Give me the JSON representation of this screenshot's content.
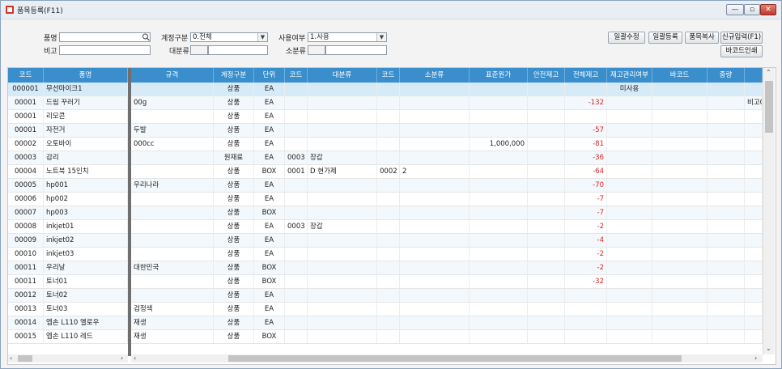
{
  "window": {
    "title": "품목등록(F11)",
    "minimize": "—",
    "maximize": "▫",
    "close": "✕"
  },
  "filters": {
    "name_label": "품명",
    "name_value": "",
    "memo_label": "비고",
    "memo_value": "",
    "account_label": "계정구분",
    "account_value": "0.전체",
    "major_label": "대분류",
    "major_value": "",
    "use_label": "사용여부",
    "use_value": "1.사용",
    "minor_label": "소분류",
    "minor_value": ""
  },
  "buttons": {
    "bulk_edit": "일괄수정",
    "bulk_register": "일괄등록",
    "copy_item": "품목복사",
    "new_input": "신규입력(F1)",
    "barcode_print": "바코드인쇄"
  },
  "columns": [
    "코드",
    "품명",
    "규격",
    "계정구분",
    "단위",
    "코드",
    "대분류",
    "코드",
    "소분류",
    "표준원가",
    "안전재고",
    "전체재고",
    "재고관리여부",
    "바코드",
    "중량",
    ""
  ],
  "rows": [
    {
      "code": "000001",
      "name": "무선마이크1",
      "spec": "",
      "acct": "상품",
      "unit": "EA",
      "mcode": "",
      "major": "",
      "scode": "",
      "minor": "",
      "cost": "",
      "safety": "",
      "total": "",
      "stockmgmt": "미사용",
      "barcode": "",
      "weight": "",
      "extra": ""
    },
    {
      "code": "00001",
      "name": "드림 꾸러기",
      "spec": "00g",
      "acct": "상품",
      "unit": "EA",
      "mcode": "",
      "major": "",
      "scode": "",
      "minor": "",
      "cost": "",
      "safety": "",
      "total": "-132",
      "stockmgmt": "",
      "barcode": "",
      "weight": "",
      "extra": "비고0"
    },
    {
      "code": "00001",
      "name": "리모콘",
      "spec": "",
      "acct": "상품",
      "unit": "EA",
      "mcode": "",
      "major": "",
      "scode": "",
      "minor": "",
      "cost": "",
      "safety": "",
      "total": "",
      "stockmgmt": "",
      "barcode": "",
      "weight": "",
      "extra": ""
    },
    {
      "code": "00001",
      "name": "자전거",
      "spec": "두발",
      "acct": "상품",
      "unit": "EA",
      "mcode": "",
      "major": "",
      "scode": "",
      "minor": "",
      "cost": "",
      "safety": "",
      "total": "-57",
      "stockmgmt": "",
      "barcode": "",
      "weight": "",
      "extra": ""
    },
    {
      "code": "00002",
      "name": "오토바이",
      "spec": "000cc",
      "acct": "상품",
      "unit": "EA",
      "mcode": "",
      "major": "",
      "scode": "",
      "minor": "",
      "cost": "1,000,000",
      "safety": "",
      "total": "-81",
      "stockmgmt": "",
      "barcode": "",
      "weight": "",
      "extra": ""
    },
    {
      "code": "00003",
      "name": "감리",
      "spec": "",
      "acct": "원재료",
      "unit": "EA",
      "mcode": "0003",
      "major": "장갑",
      "scode": "",
      "minor": "",
      "cost": "",
      "safety": "",
      "total": "-36",
      "stockmgmt": "",
      "barcode": "",
      "weight": "",
      "extra": ""
    },
    {
      "code": "00004",
      "name": "노트북 15인치",
      "spec": "",
      "acct": "상품",
      "unit": "BOX",
      "mcode": "0001",
      "major": "D 현가제",
      "scode": "0002",
      "minor": "2",
      "cost": "",
      "safety": "",
      "total": "-64",
      "stockmgmt": "",
      "barcode": "",
      "weight": "",
      "extra": ""
    },
    {
      "code": "00005",
      "name": "hp001",
      "spec": "우리나라",
      "acct": "상품",
      "unit": "EA",
      "mcode": "",
      "major": "",
      "scode": "",
      "minor": "",
      "cost": "",
      "safety": "",
      "total": "-70",
      "stockmgmt": "",
      "barcode": "",
      "weight": "",
      "extra": ""
    },
    {
      "code": "00006",
      "name": "hp002",
      "spec": "",
      "acct": "상품",
      "unit": "EA",
      "mcode": "",
      "major": "",
      "scode": "",
      "minor": "",
      "cost": "",
      "safety": "",
      "total": "-7",
      "stockmgmt": "",
      "barcode": "",
      "weight": "",
      "extra": ""
    },
    {
      "code": "00007",
      "name": "hp003",
      "spec": "",
      "acct": "상품",
      "unit": "BOX",
      "mcode": "",
      "major": "",
      "scode": "",
      "minor": "",
      "cost": "",
      "safety": "",
      "total": "-7",
      "stockmgmt": "",
      "barcode": "",
      "weight": "",
      "extra": ""
    },
    {
      "code": "00008",
      "name": "inkjet01",
      "spec": "",
      "acct": "상품",
      "unit": "EA",
      "mcode": "0003",
      "major": "장갑",
      "scode": "",
      "minor": "",
      "cost": "",
      "safety": "",
      "total": "-2",
      "stockmgmt": "",
      "barcode": "",
      "weight": "",
      "extra": ""
    },
    {
      "code": "00009",
      "name": "inkjet02",
      "spec": "",
      "acct": "상품",
      "unit": "EA",
      "mcode": "",
      "major": "",
      "scode": "",
      "minor": "",
      "cost": "",
      "safety": "",
      "total": "-4",
      "stockmgmt": "",
      "barcode": "",
      "weight": "",
      "extra": ""
    },
    {
      "code": "00010",
      "name": "inkjet03",
      "spec": "",
      "acct": "상품",
      "unit": "EA",
      "mcode": "",
      "major": "",
      "scode": "",
      "minor": "",
      "cost": "",
      "safety": "",
      "total": "-2",
      "stockmgmt": "",
      "barcode": "",
      "weight": "",
      "extra": ""
    },
    {
      "code": "00011",
      "name": "우리날",
      "spec": "대한민국",
      "acct": "상품",
      "unit": "BOX",
      "mcode": "",
      "major": "",
      "scode": "",
      "minor": "",
      "cost": "",
      "safety": "",
      "total": "-2",
      "stockmgmt": "",
      "barcode": "",
      "weight": "",
      "extra": ""
    },
    {
      "code": "00011",
      "name": "토너01",
      "spec": "",
      "acct": "상품",
      "unit": "BOX",
      "mcode": "",
      "major": "",
      "scode": "",
      "minor": "",
      "cost": "",
      "safety": "",
      "total": "-32",
      "stockmgmt": "",
      "barcode": "",
      "weight": "",
      "extra": ""
    },
    {
      "code": "00012",
      "name": "토너02",
      "spec": "",
      "acct": "상품",
      "unit": "EA",
      "mcode": "",
      "major": "",
      "scode": "",
      "minor": "",
      "cost": "",
      "safety": "",
      "total": "",
      "stockmgmt": "",
      "barcode": "",
      "weight": "",
      "extra": ""
    },
    {
      "code": "00013",
      "name": "토너03",
      "spec": "검정색",
      "acct": "상품",
      "unit": "EA",
      "mcode": "",
      "major": "",
      "scode": "",
      "minor": "",
      "cost": "",
      "safety": "",
      "total": "",
      "stockmgmt": "",
      "barcode": "",
      "weight": "",
      "extra": ""
    },
    {
      "code": "00014",
      "name": "엡손 L110 옐로우",
      "spec": "재생",
      "acct": "상품",
      "unit": "EA",
      "mcode": "",
      "major": "",
      "scode": "",
      "minor": "",
      "cost": "",
      "safety": "",
      "total": "",
      "stockmgmt": "",
      "barcode": "",
      "weight": "",
      "extra": ""
    },
    {
      "code": "00015",
      "name": "엡손 L110 레드",
      "spec": "재생",
      "acct": "상품",
      "unit": "BOX",
      "mcode": "",
      "major": "",
      "scode": "",
      "minor": "",
      "cost": "",
      "safety": "",
      "total": "",
      "stockmgmt": "",
      "barcode": "",
      "weight": "",
      "extra": ""
    }
  ],
  "colors": {
    "header": "#3a8ecb",
    "selected_row": "#d7eaf7",
    "negative": "#e02020"
  }
}
